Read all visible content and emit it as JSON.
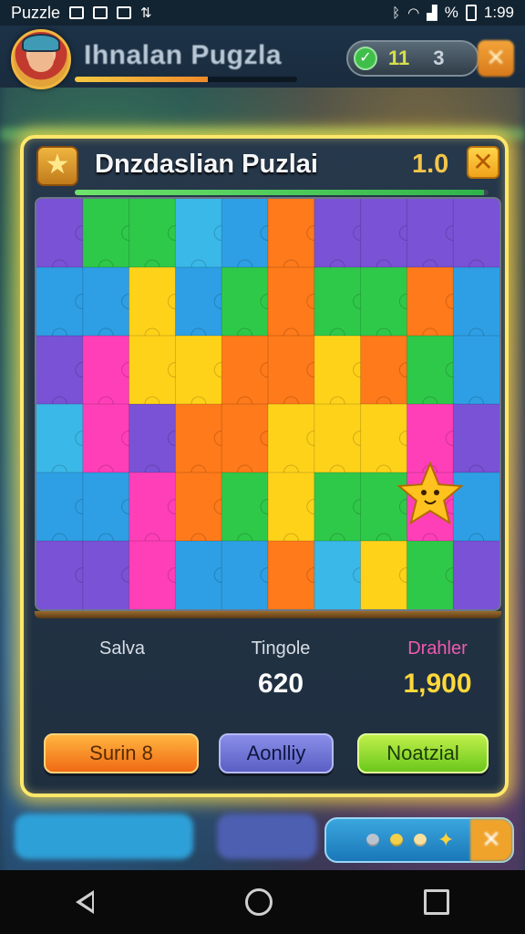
{
  "status_bar": {
    "app_label": "Puzzle",
    "battery": "%",
    "time": "1:99"
  },
  "header": {
    "title": "Ihnalan Pugzla",
    "xp_progress": 0.6,
    "counter_a": "11",
    "counter_b": "3",
    "close_glyph": "✕"
  },
  "dialog": {
    "title": "Dnzdaslian Puzlai",
    "version": "1.0",
    "close_glyph": "✕",
    "progress": 0.99,
    "star_icon": "star-icon",
    "stats": [
      {
        "label": "Salva",
        "value": ""
      },
      {
        "label": "Tingole",
        "value": "620"
      },
      {
        "label": "Drahler",
        "value": "1,900"
      }
    ],
    "buttons": [
      {
        "label": "Surin 8"
      },
      {
        "label": "Aonlliy"
      },
      {
        "label": "Noatzial"
      }
    ]
  },
  "tray": {
    "dots": [
      "#b9c3d0",
      "#f2d04a",
      "#f6e0a0"
    ],
    "star": "✦",
    "close_glyph": "✕"
  },
  "colors": {
    "accent_glow": "#ffe76a",
    "stat_value_2": "#ffffff",
    "stat_label_3": "#f05ab0",
    "stat_value_3": "#ffd83a"
  },
  "puzzle": {
    "cols": 10,
    "rows": 6,
    "palette": [
      "#7a52d6",
      "#2e9fe4",
      "#2fc94a",
      "#ff7a1a",
      "#ffd21a",
      "#ff3fb8",
      "#3ab8e8"
    ],
    "grid": [
      [
        0,
        2,
        2,
        6,
        1,
        3,
        0,
        0,
        0,
        0
      ],
      [
        1,
        1,
        4,
        1,
        2,
        3,
        2,
        2,
        3,
        1
      ],
      [
        0,
        5,
        4,
        4,
        3,
        3,
        4,
        3,
        2,
        1
      ],
      [
        6,
        5,
        0,
        3,
        3,
        4,
        4,
        4,
        5,
        0
      ],
      [
        1,
        1,
        5,
        3,
        2,
        4,
        2,
        2,
        5,
        1
      ],
      [
        0,
        0,
        5,
        1,
        1,
        3,
        6,
        4,
        2,
        0
      ]
    ],
    "star_character": "star-character-icon"
  }
}
